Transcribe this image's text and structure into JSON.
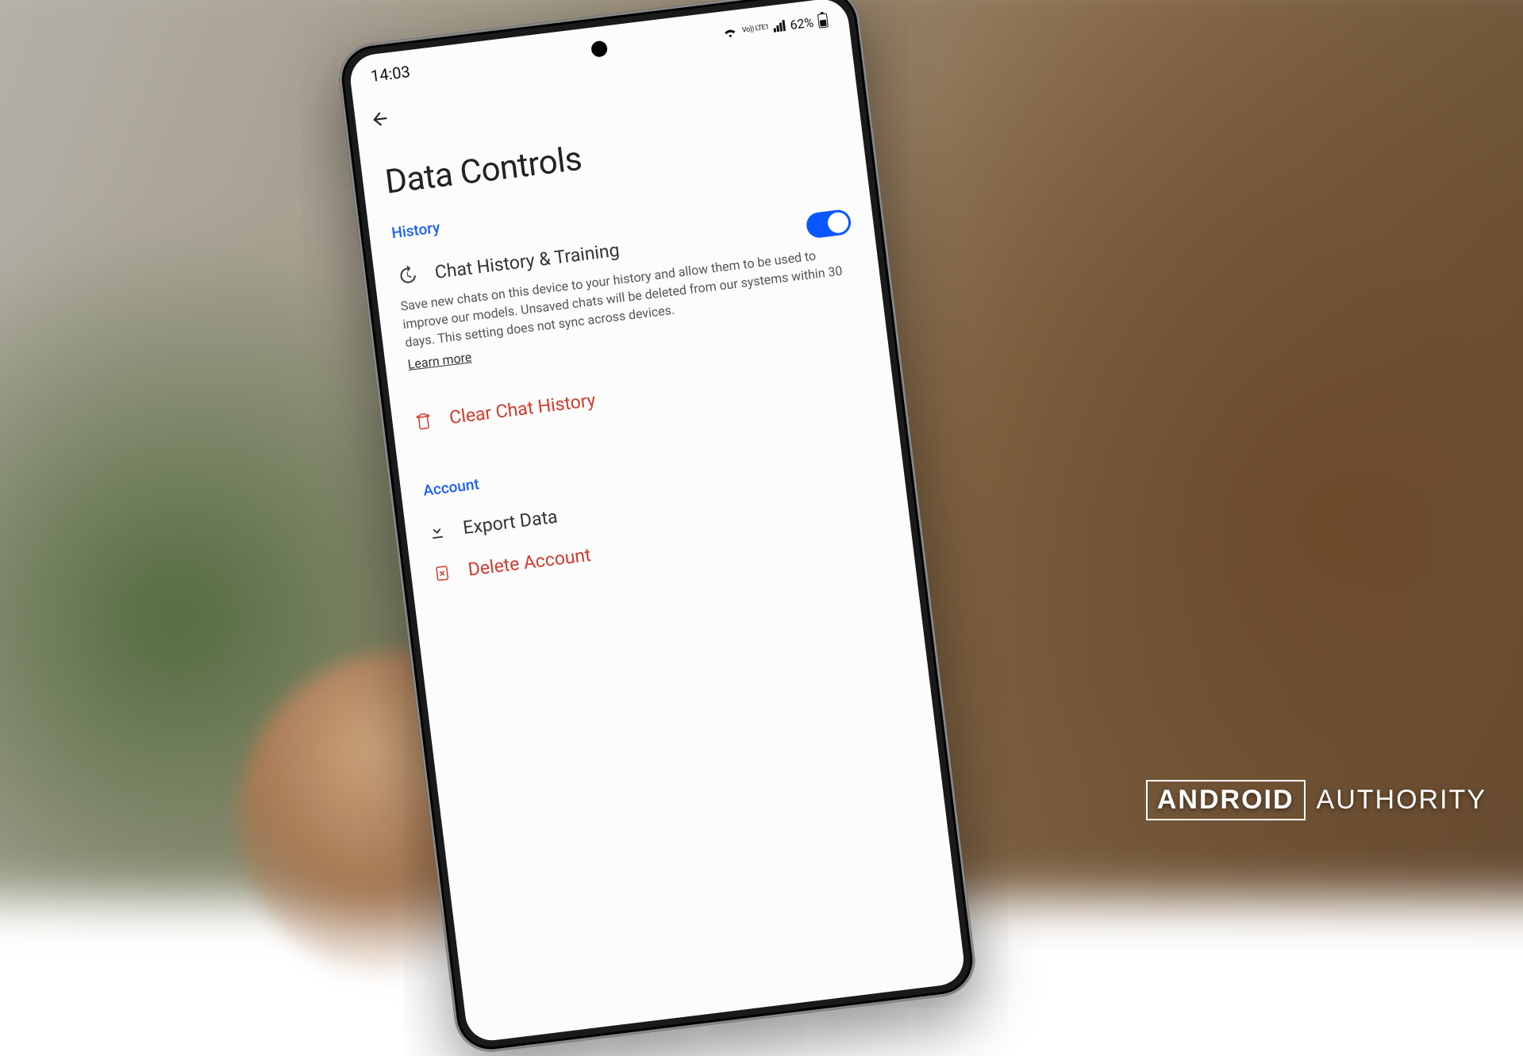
{
  "status": {
    "time": "14:03",
    "carrier": "Vo)) LTE1",
    "battery_pct": "62%"
  },
  "page": {
    "title": "Data Controls"
  },
  "sections": {
    "history": {
      "heading": "History",
      "item1_label": "Chat History & Training",
      "description": "Save new chats on this device to your history and allow them to be used to improve our models. Unsaved chats will be deleted from our systems within 30 days. This setting does not sync across devices.",
      "learn_more": "Learn more",
      "clear_label": "Clear Chat History"
    },
    "account": {
      "heading": "Account",
      "export_label": "Export Data",
      "delete_label": "Delete Account"
    }
  },
  "watermark": {
    "brand1": "ANDROID",
    "brand2": "AUTHORITY"
  }
}
